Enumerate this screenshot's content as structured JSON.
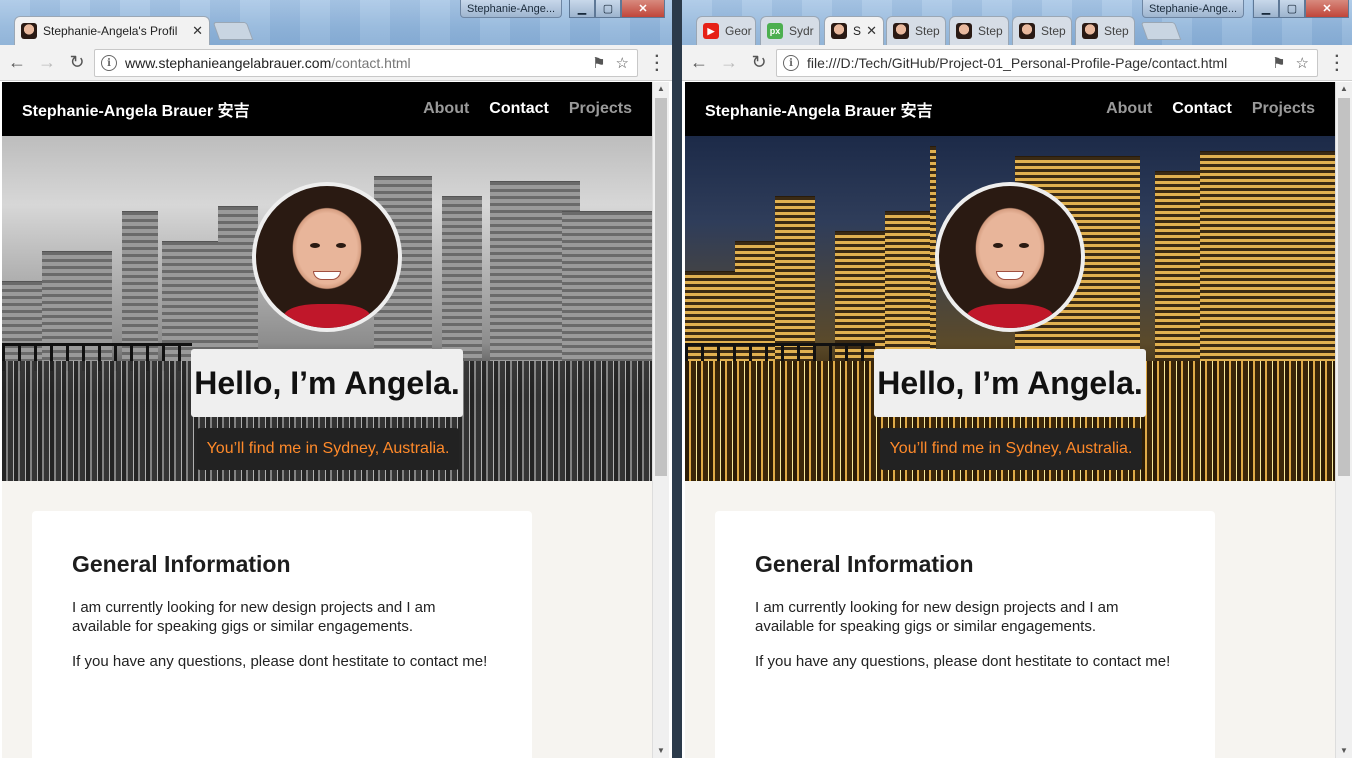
{
  "left_window": {
    "badge": "Stephanie-Ange...",
    "tabs": [
      {
        "label": "Stephanie-Angela's Profil",
        "icon": "profile-favicon-icon",
        "active": true
      }
    ],
    "address": {
      "host": "www.stephanieangelabrauer.com",
      "path": "/contact.html"
    }
  },
  "right_window": {
    "badge": "Stephanie-Ange...",
    "tabs": [
      {
        "label": "Geor",
        "icon": "youtube-favicon-icon"
      },
      {
        "label": "Sydr",
        "icon": "500px-favicon-icon"
      },
      {
        "label": "S",
        "icon": "profile-favicon-icon",
        "active": true
      },
      {
        "label": "Step",
        "icon": "profile-favicon-icon"
      },
      {
        "label": "Step",
        "icon": "profile-favicon-icon"
      },
      {
        "label": "Step",
        "icon": "profile-favicon-icon"
      },
      {
        "label": "Step",
        "icon": "profile-favicon-icon"
      }
    ],
    "address": {
      "url": "file:///D:/Tech/GitHub/Project-01_Personal-Profile-Page/contact.html"
    }
  },
  "site": {
    "brand": "Stephanie-Angela Brauer 安吉",
    "nav": [
      {
        "label": "About",
        "active": false
      },
      {
        "label": "Contact",
        "active": true
      },
      {
        "label": "Projects",
        "active": false
      }
    ],
    "hero": {
      "greeting": "Hello, I’m Angela.",
      "location": "You’ll find me in Sydney, Australia."
    },
    "card": {
      "heading": "General Information",
      "paragraphs": [
        "I am currently looking for new design projects and I am available for speaking gigs or similar engagements.",
        "If you have any questions, please dont hestitate to contact me!"
      ]
    }
  },
  "colors": {
    "nav_bg": "#000000",
    "location_text": "#ff8a2a",
    "page_bg": "#f6f4f0"
  }
}
